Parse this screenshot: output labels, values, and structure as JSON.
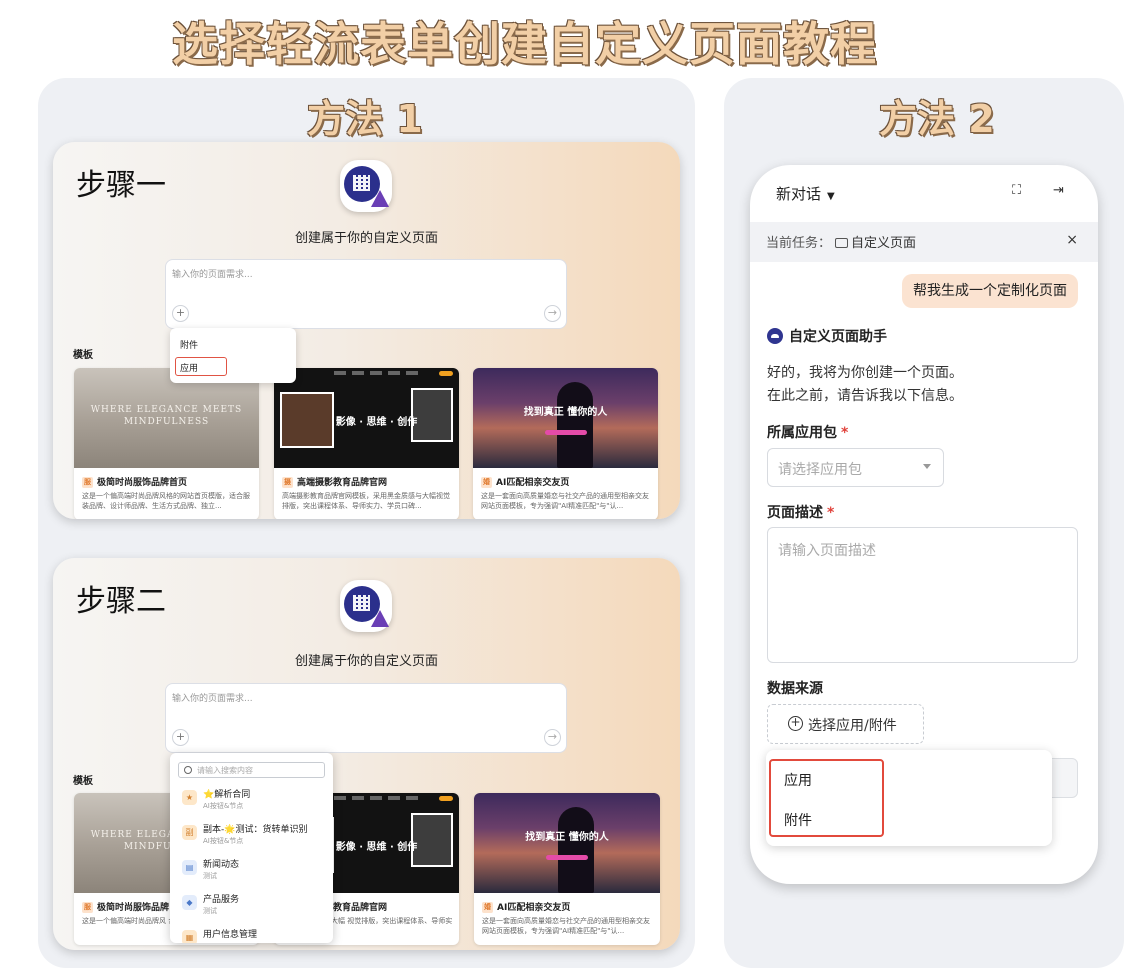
{
  "main_title": "选择轻流表单创建自定义页面教程",
  "method1": {
    "title": "方法 1",
    "steps": [
      {
        "label": "步骤一",
        "heading": "创建属于你的自定义页面",
        "prompt_placeholder": "输入你的页面需求...",
        "plus": "+",
        "send": "→",
        "templates_label": "模板",
        "menu": [
          "附件",
          "应用"
        ]
      },
      {
        "label": "步骤二",
        "heading": "创建属于你的自定义页面",
        "prompt_placeholder": "输入你的页面需求...",
        "plus": "+",
        "send": "→",
        "templates_label": "模板",
        "search_placeholder": "请输入搜索内容",
        "menu_items": [
          {
            "name": "⭐解析合同",
            "sub": "AI按钮&节点",
            "icon": "star-icon"
          },
          {
            "name": "副本-🌟测试：货转单识别",
            "sub": "AI按钮&节点",
            "icon": "copy-icon"
          },
          {
            "name": "新闻动态",
            "sub": "测试",
            "icon": "document-icon"
          },
          {
            "name": "产品服务",
            "sub": "测试",
            "icon": "box-icon"
          },
          {
            "name": "用户信息管理",
            "sub": "",
            "icon": "table-icon"
          }
        ]
      }
    ],
    "templates": [
      {
        "badge": "服",
        "title": "极简时尚服饰品牌首页",
        "desc": "这是一个偏高端时尚品牌风格的网站首页模版，适合服装品牌、设计师品牌、生活方式品牌、独立...",
        "img_text": "WHERE ELEGANCE MEETS MINDFULNESS"
      },
      {
        "badge": "摄",
        "title": "高端摄影教育品牌官网",
        "desc": "高端摄影教育品牌官网模板，采用黑金质感与大幅视觉排版，突出课程体系、导师实力、学员口碑...",
        "img_text": "影像 · 思维 · 创作"
      },
      {
        "badge": "婚",
        "title": "AI匹配相亲交友页",
        "desc": "这是一套面向高质量婚恋与社交产品的通用型相亲交友网站页面模板，专为强调\"AI精准匹配\"与\"认...",
        "img_text": "找到真正 懂你的人"
      }
    ],
    "step2_templates_titles": [
      "极简时尚服饰品牌",
      "高端摄影教育品牌官网",
      "AI匹配相亲交友页"
    ],
    "step2_templates_desc": [
      "这是一个偏高端时尚品牌风\n合服装品牌、设计师品牌、",
      "采用黑金质感与大幅\n视觉排版，突出课程体系、导师实力、学员口碑...",
      "这是一套面向高质量婚恋与社交产品的通用型相亲交友网站页面模板，专为强调\"AI精准匹配\"与\"认..."
    ]
  },
  "method2": {
    "title": "方法 2",
    "chat": {
      "header_title": "新对话",
      "task_label": "当前任务：",
      "task_page": "自定义页面",
      "close": "×",
      "user_message": "帮我生成一个定制化页面",
      "assistant_name": "自定义页面助手",
      "assistant_text_line1": "好的，我将为你创建一个页面。",
      "assistant_text_line2": "在此之前，请告诉我以下信息。",
      "field_package_label": "所属应用包",
      "field_package_placeholder": "请选择应用包",
      "field_desc_label": "页面描述",
      "field_desc_placeholder": "请输入页面描述",
      "field_source_label": "数据来源",
      "source_button": "选择应用/附件",
      "required_mark": "*",
      "source_options": [
        "应用",
        "附件"
      ]
    }
  },
  "colors": {
    "title_fill": "#f2cfa6",
    "panel_bg": "#eef0f4",
    "highlight_red": "#e24a3c",
    "brand_blue": "#2b2f8c"
  }
}
